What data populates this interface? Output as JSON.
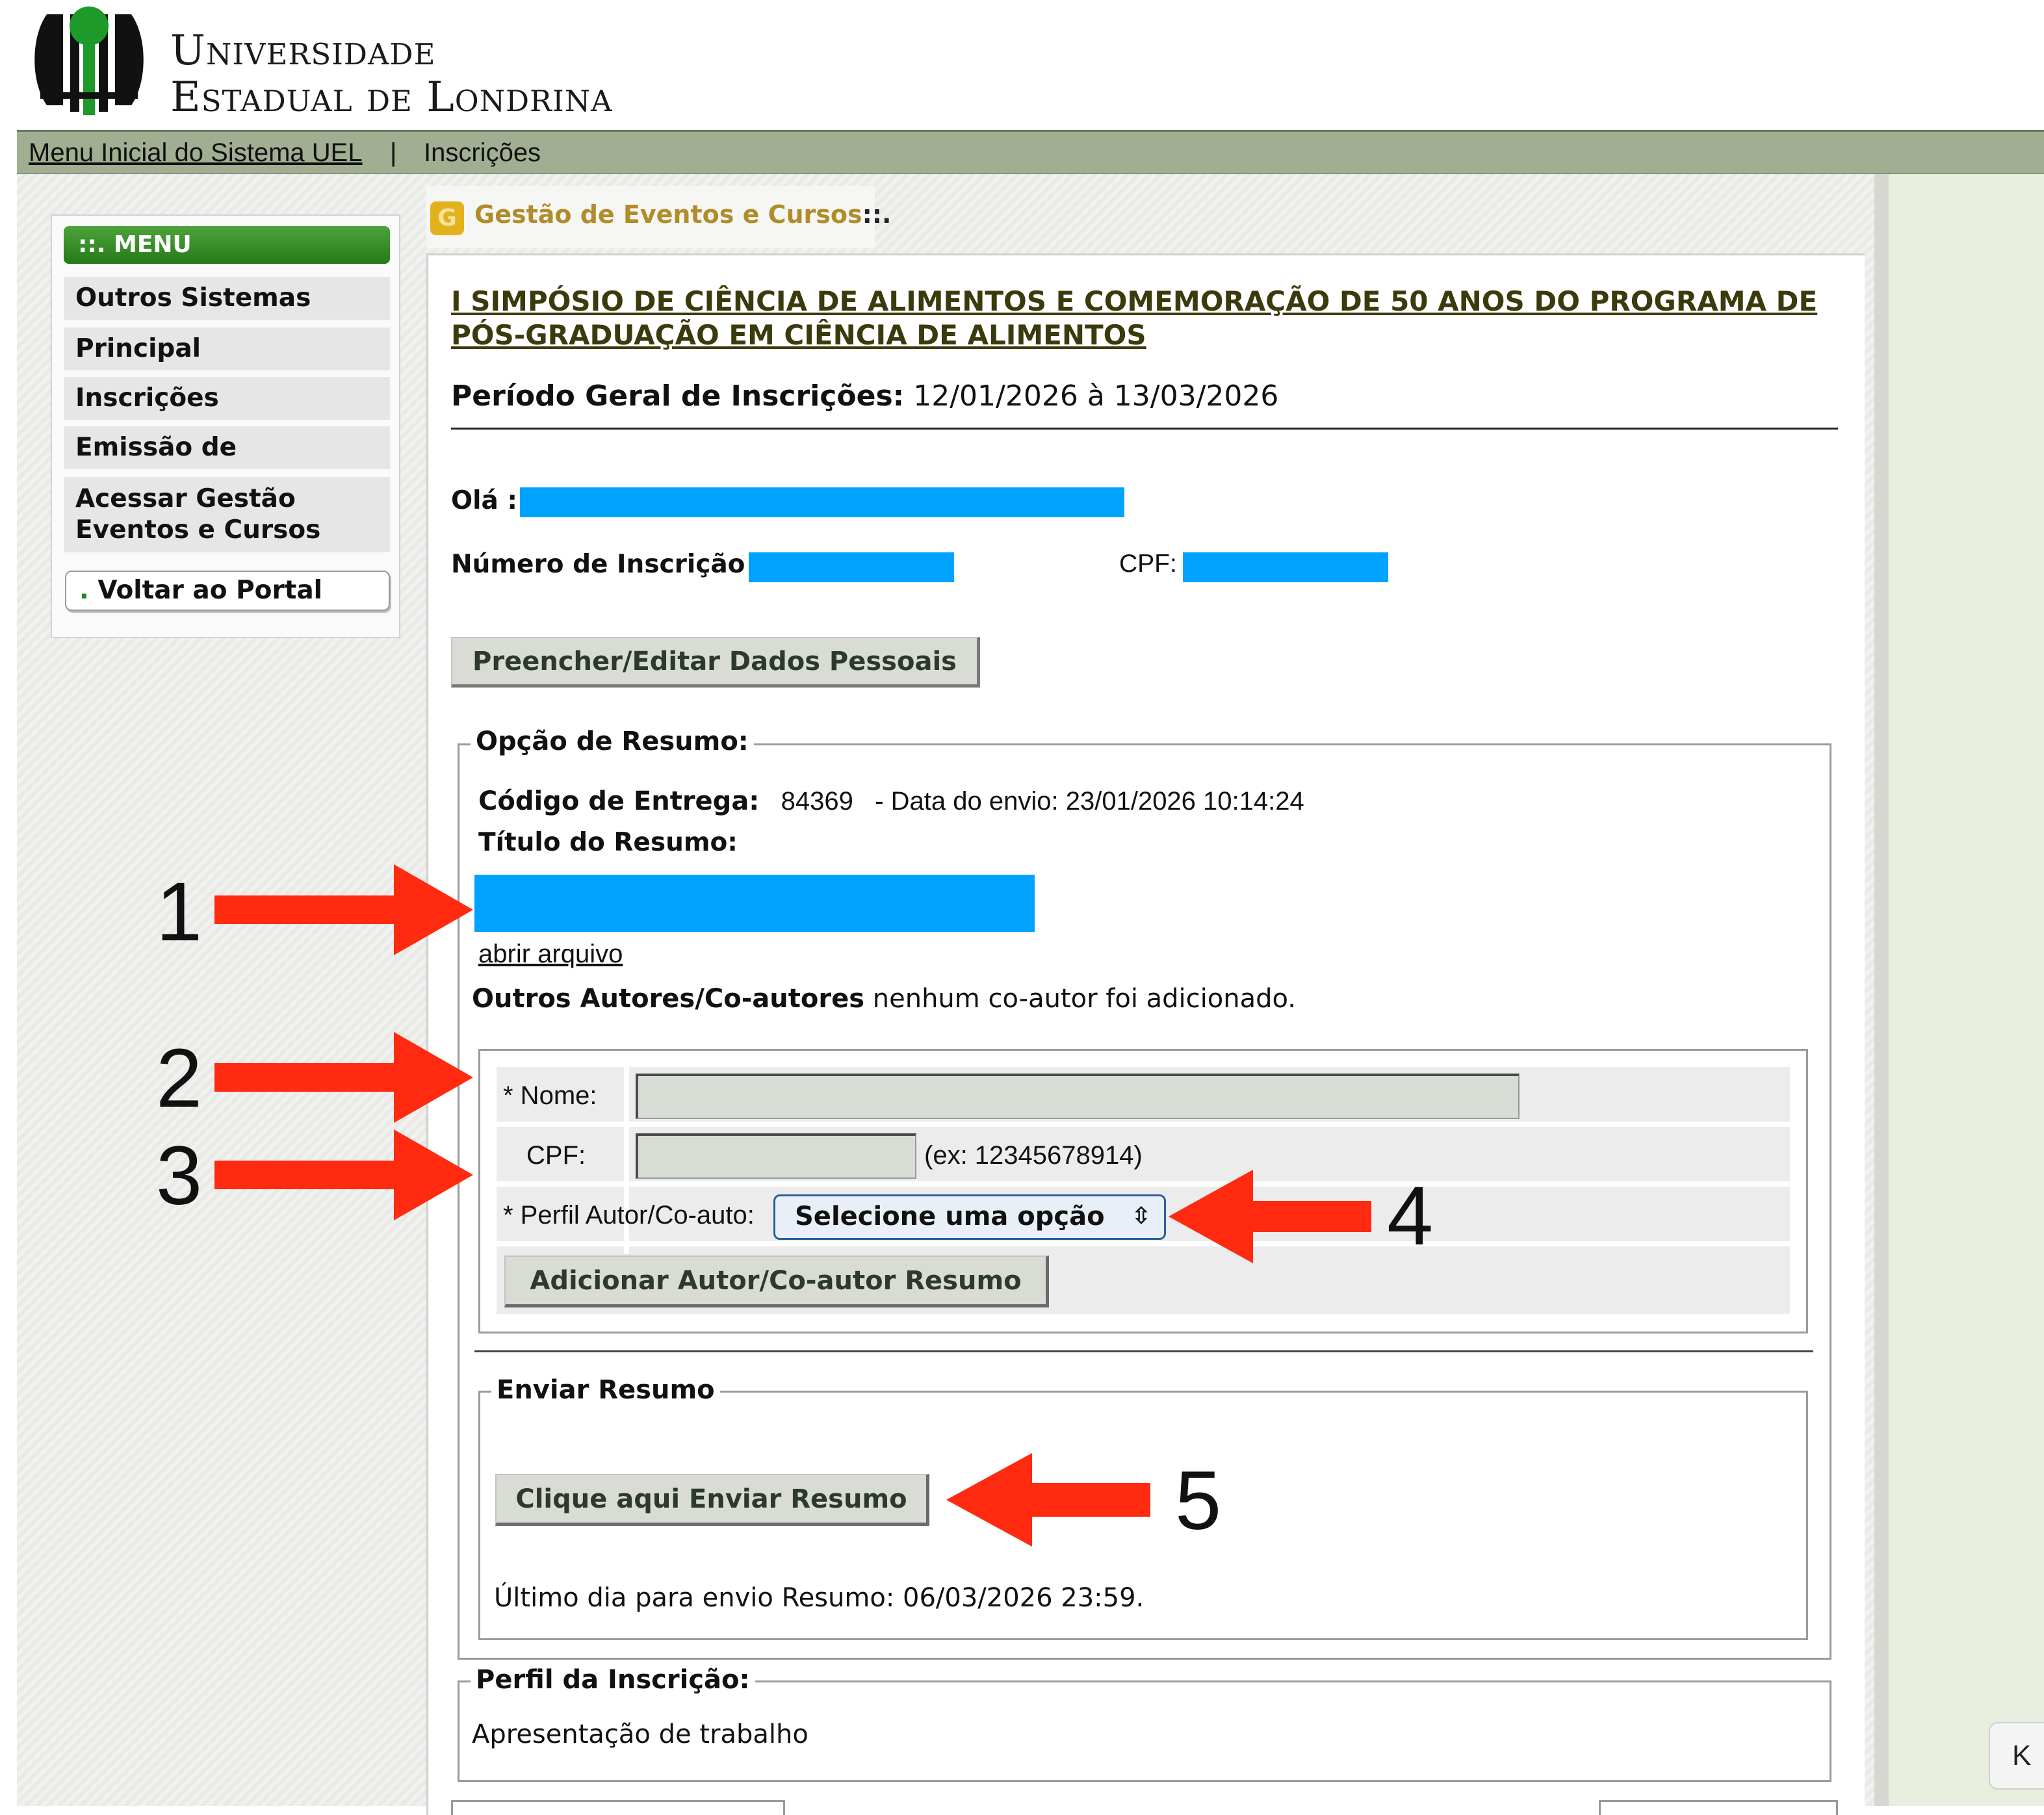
{
  "header": {
    "logo_line1": "Universidade",
    "logo_line2": "Estadual de Londrina"
  },
  "topnav": {
    "menu_link": "Menu Inicial do Sistema UEL",
    "separator": "|",
    "current": "Inscrições"
  },
  "sidebar": {
    "menu_title": "::. MENU",
    "items": [
      {
        "label": "Outros Sistemas"
      },
      {
        "label": "Principal"
      },
      {
        "label": "Inscrições"
      },
      {
        "label": "Emissão de Certificados"
      },
      {
        "label": "Acessar Gestão Eventos e Cursos"
      }
    ],
    "back_dot": ".",
    "back_label": "Voltar ao Portal"
  },
  "content": {
    "icon_letter": "G",
    "section_title": "Gestão de Eventos e Cursos",
    "section_title_suffix": "::.",
    "event_title": "I SIMPÓSIO DE CIÊNCIA DE ALIMENTOS E COMEMORAÇÃO DE 50 ANOS DO PROGRAMA DE PÓS-GRADUAÇÃO EM CIÊNCIA DE ALIMENTOS",
    "periodo_label": "Período Geral de Inscrições:",
    "periodo_value": "12/01/2026 à 13/03/2026",
    "ola_label": "Olá :",
    "numero_label": "Número de Inscrição :",
    "cpf_label": "CPF:",
    "btn_dados": "Preencher/Editar Dados Pessoais"
  },
  "resumo": {
    "legend": "Opção de Resumo:",
    "codigo_label": "Código de Entrega:",
    "codigo_value": "84369",
    "data_envio": "-  Data do envio: 23/01/2026 10:14:24",
    "titulo_label": "Título do Resumo:",
    "abrir_link": "abrir arquivo",
    "autores_label": "Outros Autores/Co-autores",
    "autores_value": "nenhum co-autor foi adicionado."
  },
  "coautor_form": {
    "nome_label": "* Nome:",
    "nome_value": "",
    "cpf_label": "CPF:",
    "cpf_value": "",
    "cpf_hint": "(ex: 12345678914)",
    "perfil_label": "* Perfil Autor/Co-auto:",
    "perfil_selected": "Selecione uma opção",
    "btn_add": "Adicionar Autor/Co-autor Resumo"
  },
  "enviar": {
    "legend": "Enviar Resumo",
    "btn": "Clique aqui Enviar Resumo",
    "ultimo_dia": "Último dia para envio Resumo: 06/03/2026 23:59."
  },
  "perfil": {
    "legend": "Perfil da Inscrição:",
    "value": "Apresentação de trabalho"
  },
  "right_widget": "K",
  "annotations": [
    "1",
    "2",
    "3",
    "4",
    "5"
  ],
  "colors": {
    "redaction": "#00a2ff",
    "arrow": "#ff2a10",
    "topnav": "#a2ae92",
    "menu_green": "#2e8a1f",
    "title_gold": "#b08c2a"
  },
  "icons": {
    "logo": "uel-logo-icon",
    "section": "g-badge-icon",
    "select": "chevron-updown-icon",
    "annotation": "red-arrow-icon"
  }
}
